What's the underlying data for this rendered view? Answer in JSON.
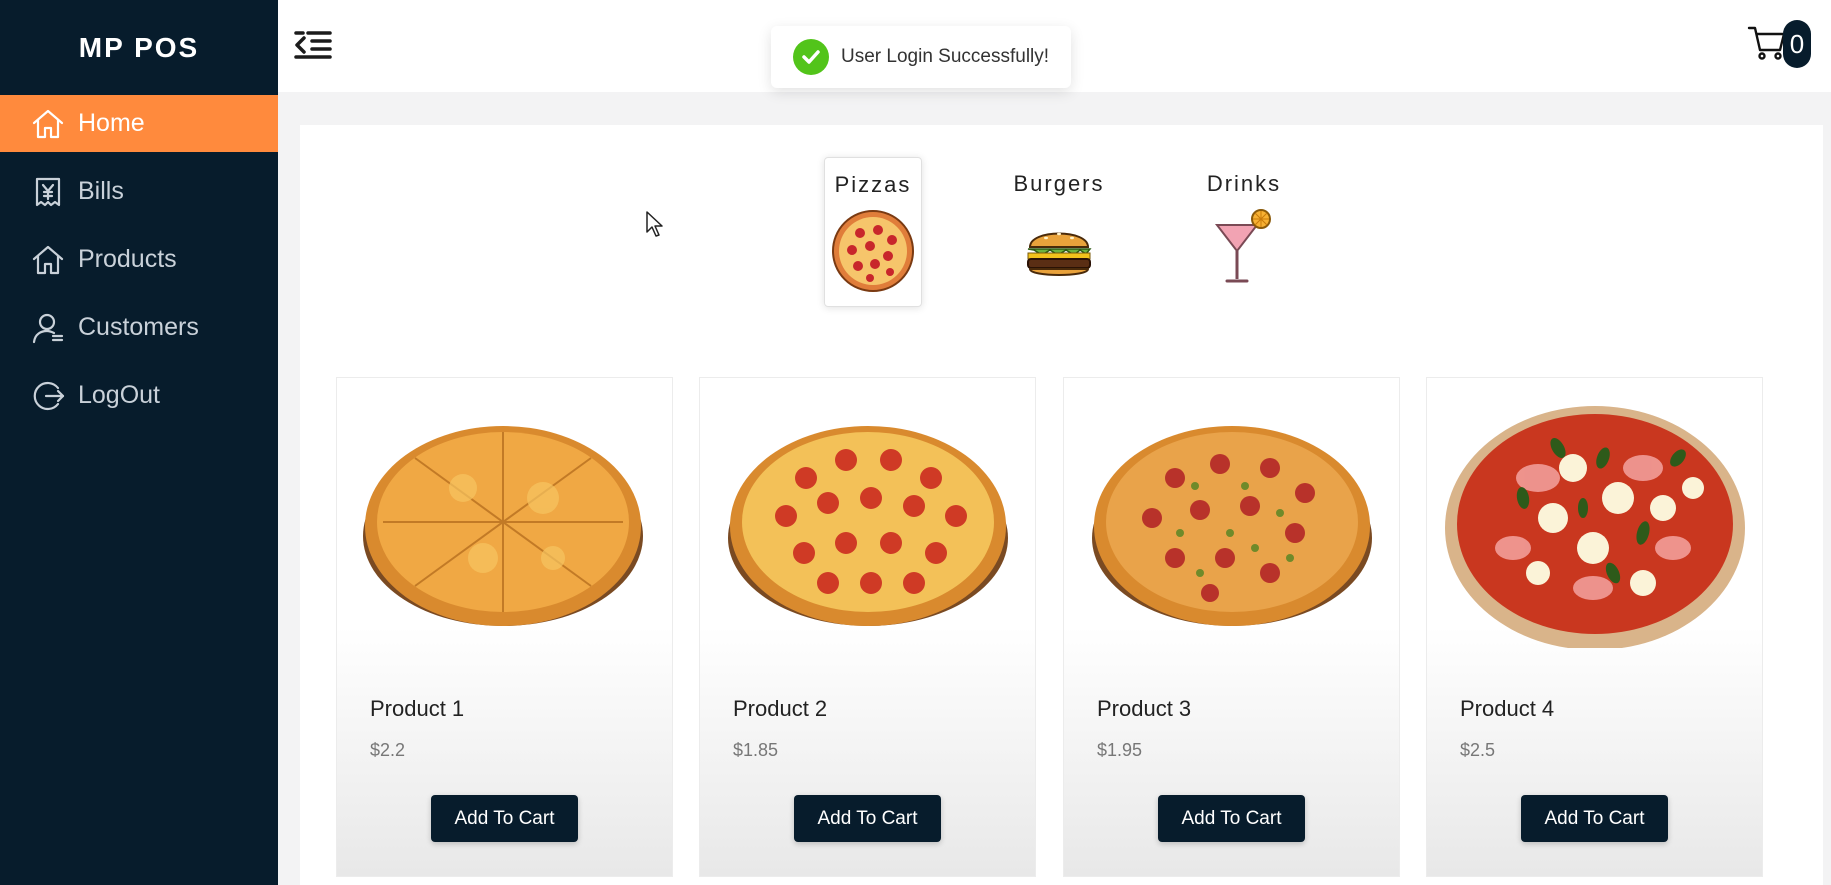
{
  "app": {
    "title": "MP POS"
  },
  "sidebar": {
    "items": [
      {
        "label": "Home",
        "icon": "home-icon",
        "active": true
      },
      {
        "label": "Bills",
        "icon": "bill-icon",
        "active": false
      },
      {
        "label": "Products",
        "icon": "home-icon",
        "active": false
      },
      {
        "label": "Customers",
        "icon": "user-icon",
        "active": false
      },
      {
        "label": "LogOut",
        "icon": "logout-icon",
        "active": false
      }
    ]
  },
  "header": {
    "menu_icon": "menu-fold-icon",
    "cart_icon": "shopping-cart-icon",
    "cart_count": "0"
  },
  "toast": {
    "message": "User Login Successfully!",
    "icon": "check-circle-icon"
  },
  "categories": [
    {
      "label": "Pizzas",
      "icon": "pizza-icon",
      "active": true
    },
    {
      "label": "Burgers",
      "icon": "burger-icon",
      "active": false
    },
    {
      "label": "Drinks",
      "icon": "cocktail-icon",
      "active": false
    }
  ],
  "products": [
    {
      "name": "Product 1",
      "price": "$2.2",
      "button": "Add To Cart",
      "image": "cheese-pizza-image"
    },
    {
      "name": "Product 2",
      "price": "$1.85",
      "button": "Add To Cart",
      "image": "pepperoni-pizza-image"
    },
    {
      "name": "Product 3",
      "price": "$1.95",
      "button": "Add To Cart",
      "image": "supreme-pizza-image"
    },
    {
      "name": "Product 4",
      "price": "$2.5",
      "button": "Add To Cart",
      "image": "margherita-pizza-image"
    }
  ],
  "colors": {
    "sidebar_bg": "#071c2c",
    "active_nav": "#ff8a3d",
    "button_bg": "#071c2c",
    "toast_success": "#52c41a"
  }
}
